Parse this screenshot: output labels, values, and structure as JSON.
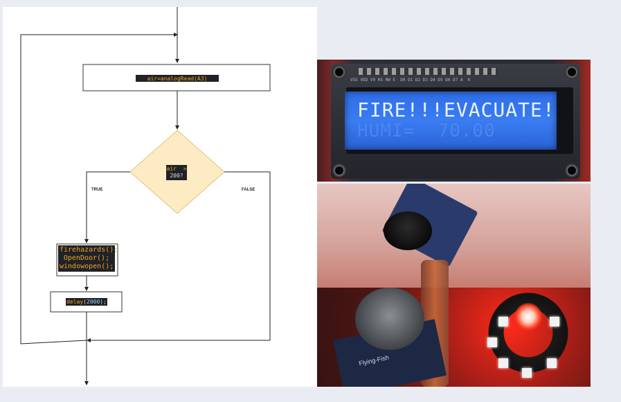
{
  "flowchart": {
    "step_read": "air=analogRead(A3)",
    "decision_line1": "air  >",
    "decision_line2": "200?",
    "true_label": "TRUE",
    "false_label": "FALSE",
    "action_lines": [
      "firehazards();",
      "OpenDoor();",
      "windowopen();"
    ],
    "delay_fn": "delay",
    "delay_arg": "2000",
    "delay_tail": ");",
    "delay_open": "("
  },
  "lcd_photo": {
    "line1": "FIRE!!!EVACUATE!",
    "line2": "HUMI=  70.00",
    "pin_labels": "VSS VDD V0 RS RW E  D0 D1 D2 D3 D4 D5 D6 D7 A  K"
  },
  "sensor_photo": {
    "gas_sensor_label": "Flying-Fish"
  },
  "colors": {
    "code_bg": "#1f2227",
    "code_keyword": "#f4a522",
    "decision_fill": "#fdebc4",
    "decision_stroke": "#e2c17a",
    "lcd_backlight": "#3a7cf2"
  }
}
